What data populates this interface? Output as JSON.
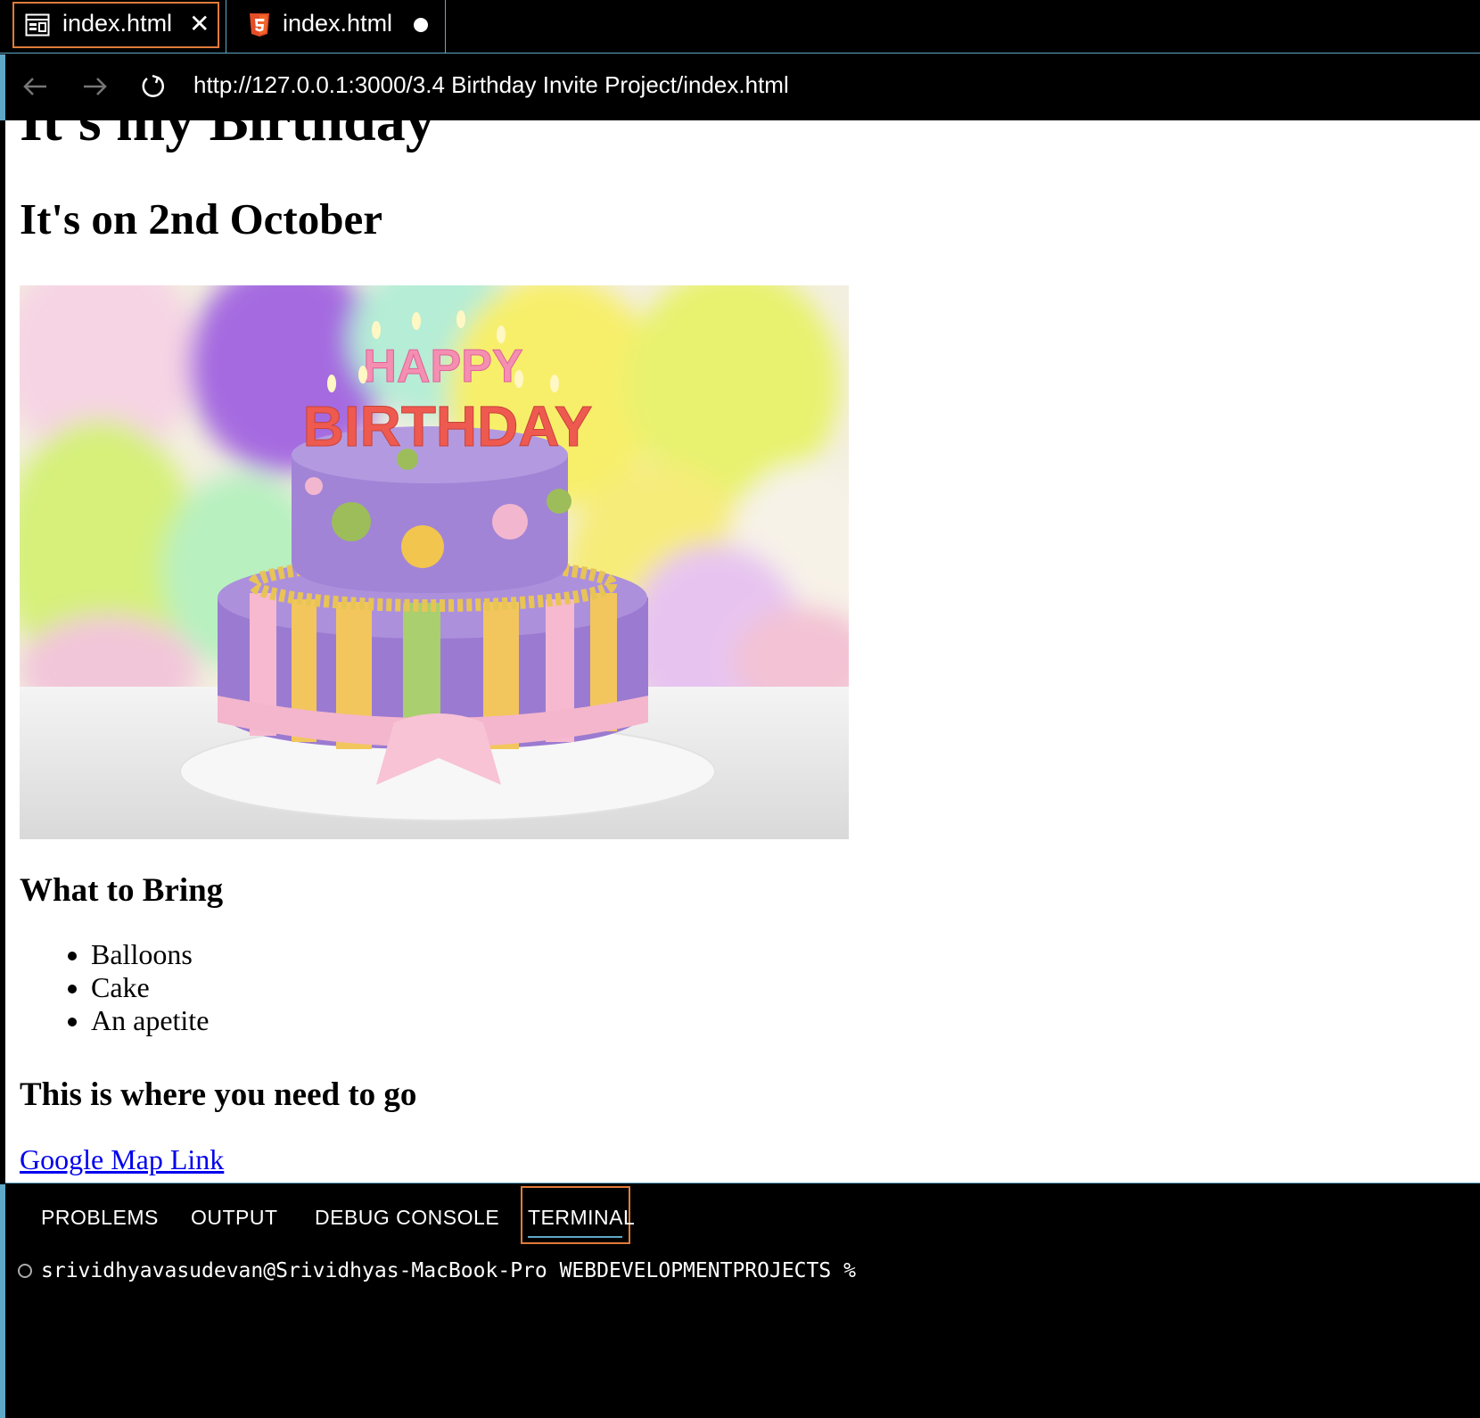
{
  "tabs": [
    {
      "label": "index.html",
      "icon": "preview-icon",
      "active": true,
      "closable": true
    },
    {
      "label": "index.html",
      "icon": "html5-icon",
      "modified": true
    }
  ],
  "nav": {
    "url": "http://127.0.0.1:3000/3.4 Birthday Invite Project/index.html"
  },
  "page": {
    "title": "It's my Birthday",
    "date_heading": "It's on 2nd October",
    "image": {
      "decor_text_line1": "HAPPY",
      "decor_text_line2": "BIRTHDAY"
    },
    "bring_heading": "What to Bring",
    "bring_items": [
      "Balloons",
      "Cake",
      "An apetite"
    ],
    "go_heading": "This is where you need to go",
    "map_link": "Google Map Link"
  },
  "panel": {
    "tabs": [
      "PROBLEMS",
      "OUTPUT",
      "DEBUG CONSOLE",
      "TERMINAL"
    ],
    "active_tab": "TERMINAL",
    "terminal_prompt": "srividhyavasudevan@Srividhyas-MacBook-Pro WEBDEVELOPMENTPROJECTS %"
  },
  "colors": {
    "focus_border": "#e07b39",
    "accent_blue": "#5fa8c8",
    "link": "#0000ee",
    "html5": "#e44d26"
  }
}
